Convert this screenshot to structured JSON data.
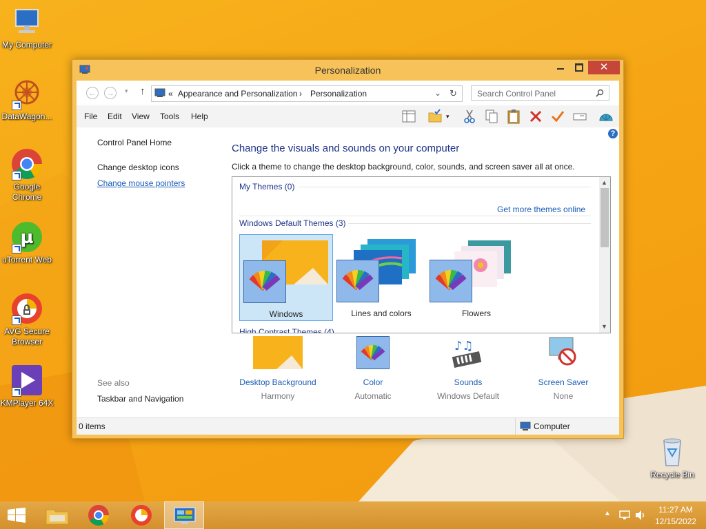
{
  "desktop": {
    "icons": [
      {
        "label": "My Computer"
      },
      {
        "label": "DataWagon..."
      },
      {
        "label": "Google Chrome"
      },
      {
        "label": "uTorrent Web"
      },
      {
        "label": "AVG Secure Browser"
      },
      {
        "label": "KMPlayer 64X"
      },
      {
        "label": "Recycle Bin"
      }
    ]
  },
  "window": {
    "title": "Personalization",
    "close_glyph": "✕",
    "address": {
      "chevrons": "«",
      "crumb1": "Appearance and Personalization",
      "separator": "›",
      "crumb2": "Personalization",
      "search_placeholder": "Search Control Panel"
    },
    "menu": [
      "File",
      "Edit",
      "View",
      "Tools",
      "Help"
    ],
    "left": {
      "home": "Control Panel Home",
      "desktop_icons": "Change desktop icons",
      "mouse_pointers": "Change mouse pointers",
      "see_also": "See also",
      "taskbar_nav": "Taskbar and Navigation"
    },
    "main": {
      "title": "Change the visuals and sounds on your computer",
      "description": "Click a theme to change the desktop background, color, sounds, and screen saver all at once.",
      "my_themes": "My Themes (0)",
      "get_more": "Get more themes online",
      "default_themes": "Windows Default Themes (3)",
      "high_contrast": "High Contrast Themes (4)",
      "themes": [
        {
          "label": "Windows"
        },
        {
          "label": "Lines and colors"
        },
        {
          "label": "Flowers"
        }
      ],
      "settings": [
        {
          "title": "Desktop Background",
          "sub": "Harmony"
        },
        {
          "title": "Color",
          "sub": "Automatic"
        },
        {
          "title": "Sounds",
          "sub": "Windows Default"
        },
        {
          "title": "Screen Saver",
          "sub": "None"
        }
      ]
    },
    "status": {
      "items": "0 items",
      "location": "Computer"
    }
  },
  "taskbar": {
    "time": "11:27 AM",
    "date": "12/15/2022"
  }
}
